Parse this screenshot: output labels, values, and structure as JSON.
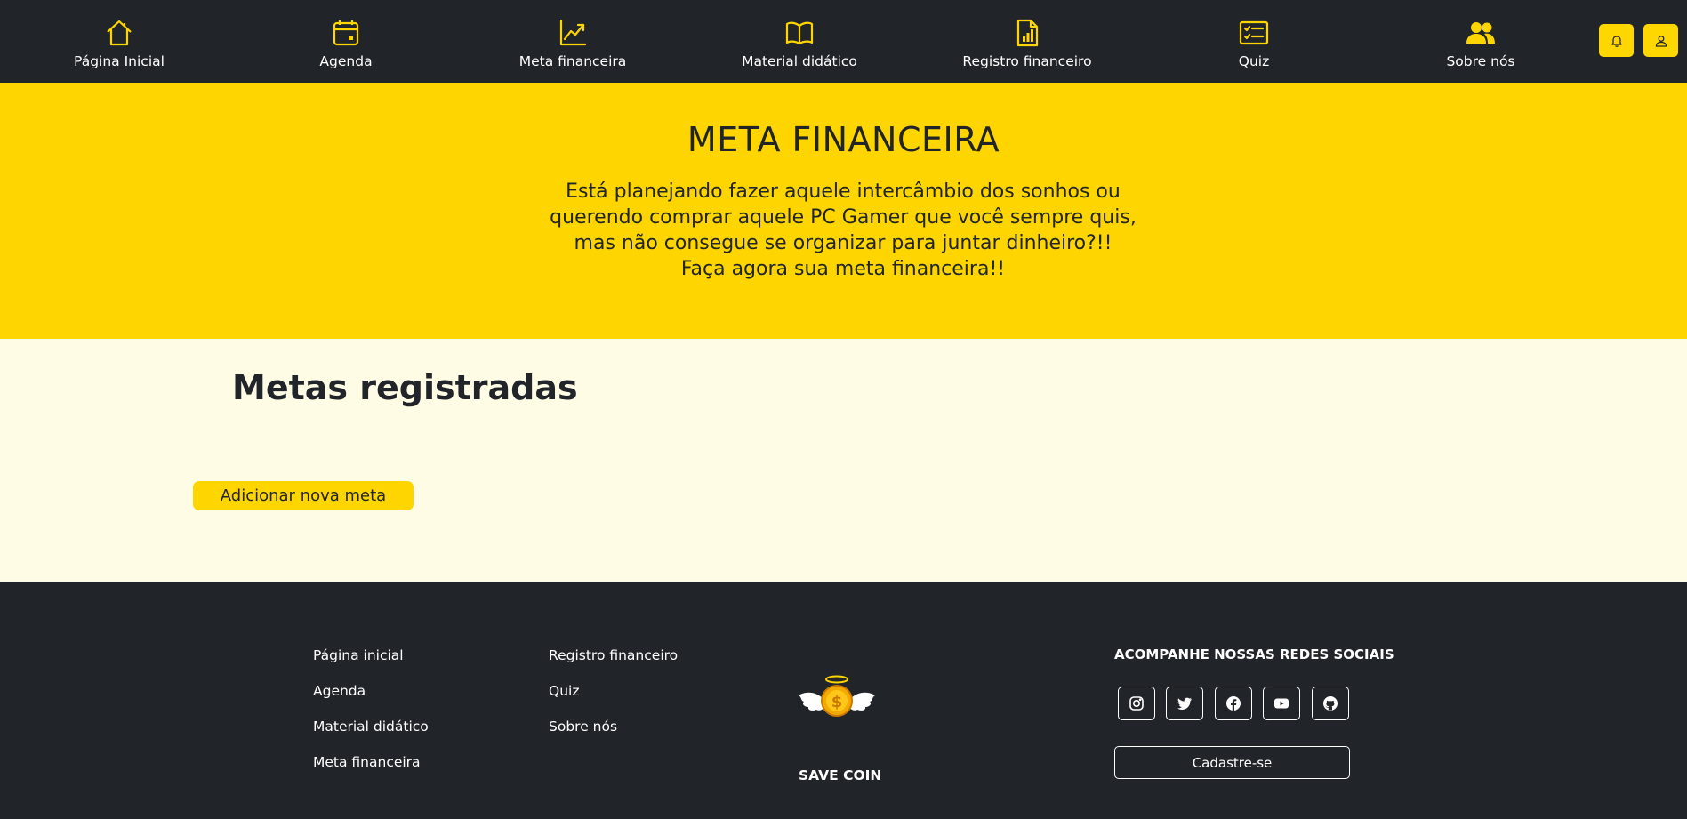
{
  "nav": {
    "items": [
      {
        "label": "Página Inicial",
        "icon": "home-icon"
      },
      {
        "label": "Agenda",
        "icon": "calendar-icon"
      },
      {
        "label": "Meta financeira",
        "icon": "chart-line-icon"
      },
      {
        "label": "Material didático",
        "icon": "book-icon"
      },
      {
        "label": "Registro financeiro",
        "icon": "file-chart-icon"
      },
      {
        "label": "Quiz",
        "icon": "checklist-icon"
      },
      {
        "label": "Sobre nós",
        "icon": "people-icon"
      }
    ],
    "buttons": [
      {
        "icon": "bell-icon"
      },
      {
        "icon": "user-icon"
      }
    ],
    "accent_color": "#ffd700",
    "background_color": "#212529"
  },
  "hero": {
    "title": "META FINANCEIRA",
    "description_lines": [
      "Está planejando fazer aquele intercâmbio dos sonhos ou",
      "querendo comprar aquele PC Gamer que você sempre quis,",
      "mas não consegue se organizar para juntar dinheiro?!!",
      "Faça agora sua meta financeira!!"
    ],
    "background_color": "#ffd500"
  },
  "main": {
    "title": "Metas registradas",
    "add_button_label": "Adicionar nova meta",
    "background_color": "#fffce6"
  },
  "footer": {
    "links_col1": [
      "Página inicial",
      "Agenda",
      "Material didático",
      "Meta financeira"
    ],
    "links_col2": [
      "Registro financeiro",
      "Quiz",
      "Sobre nós"
    ],
    "brand": "SAVE COIN",
    "social_title": "ACOMPANHE NOSSAS REDES SOCIAIS",
    "social_icons": [
      "instagram-icon",
      "twitter-icon",
      "facebook-icon",
      "youtube-icon",
      "github-icon"
    ],
    "signup_label": "Cadastre-se"
  }
}
